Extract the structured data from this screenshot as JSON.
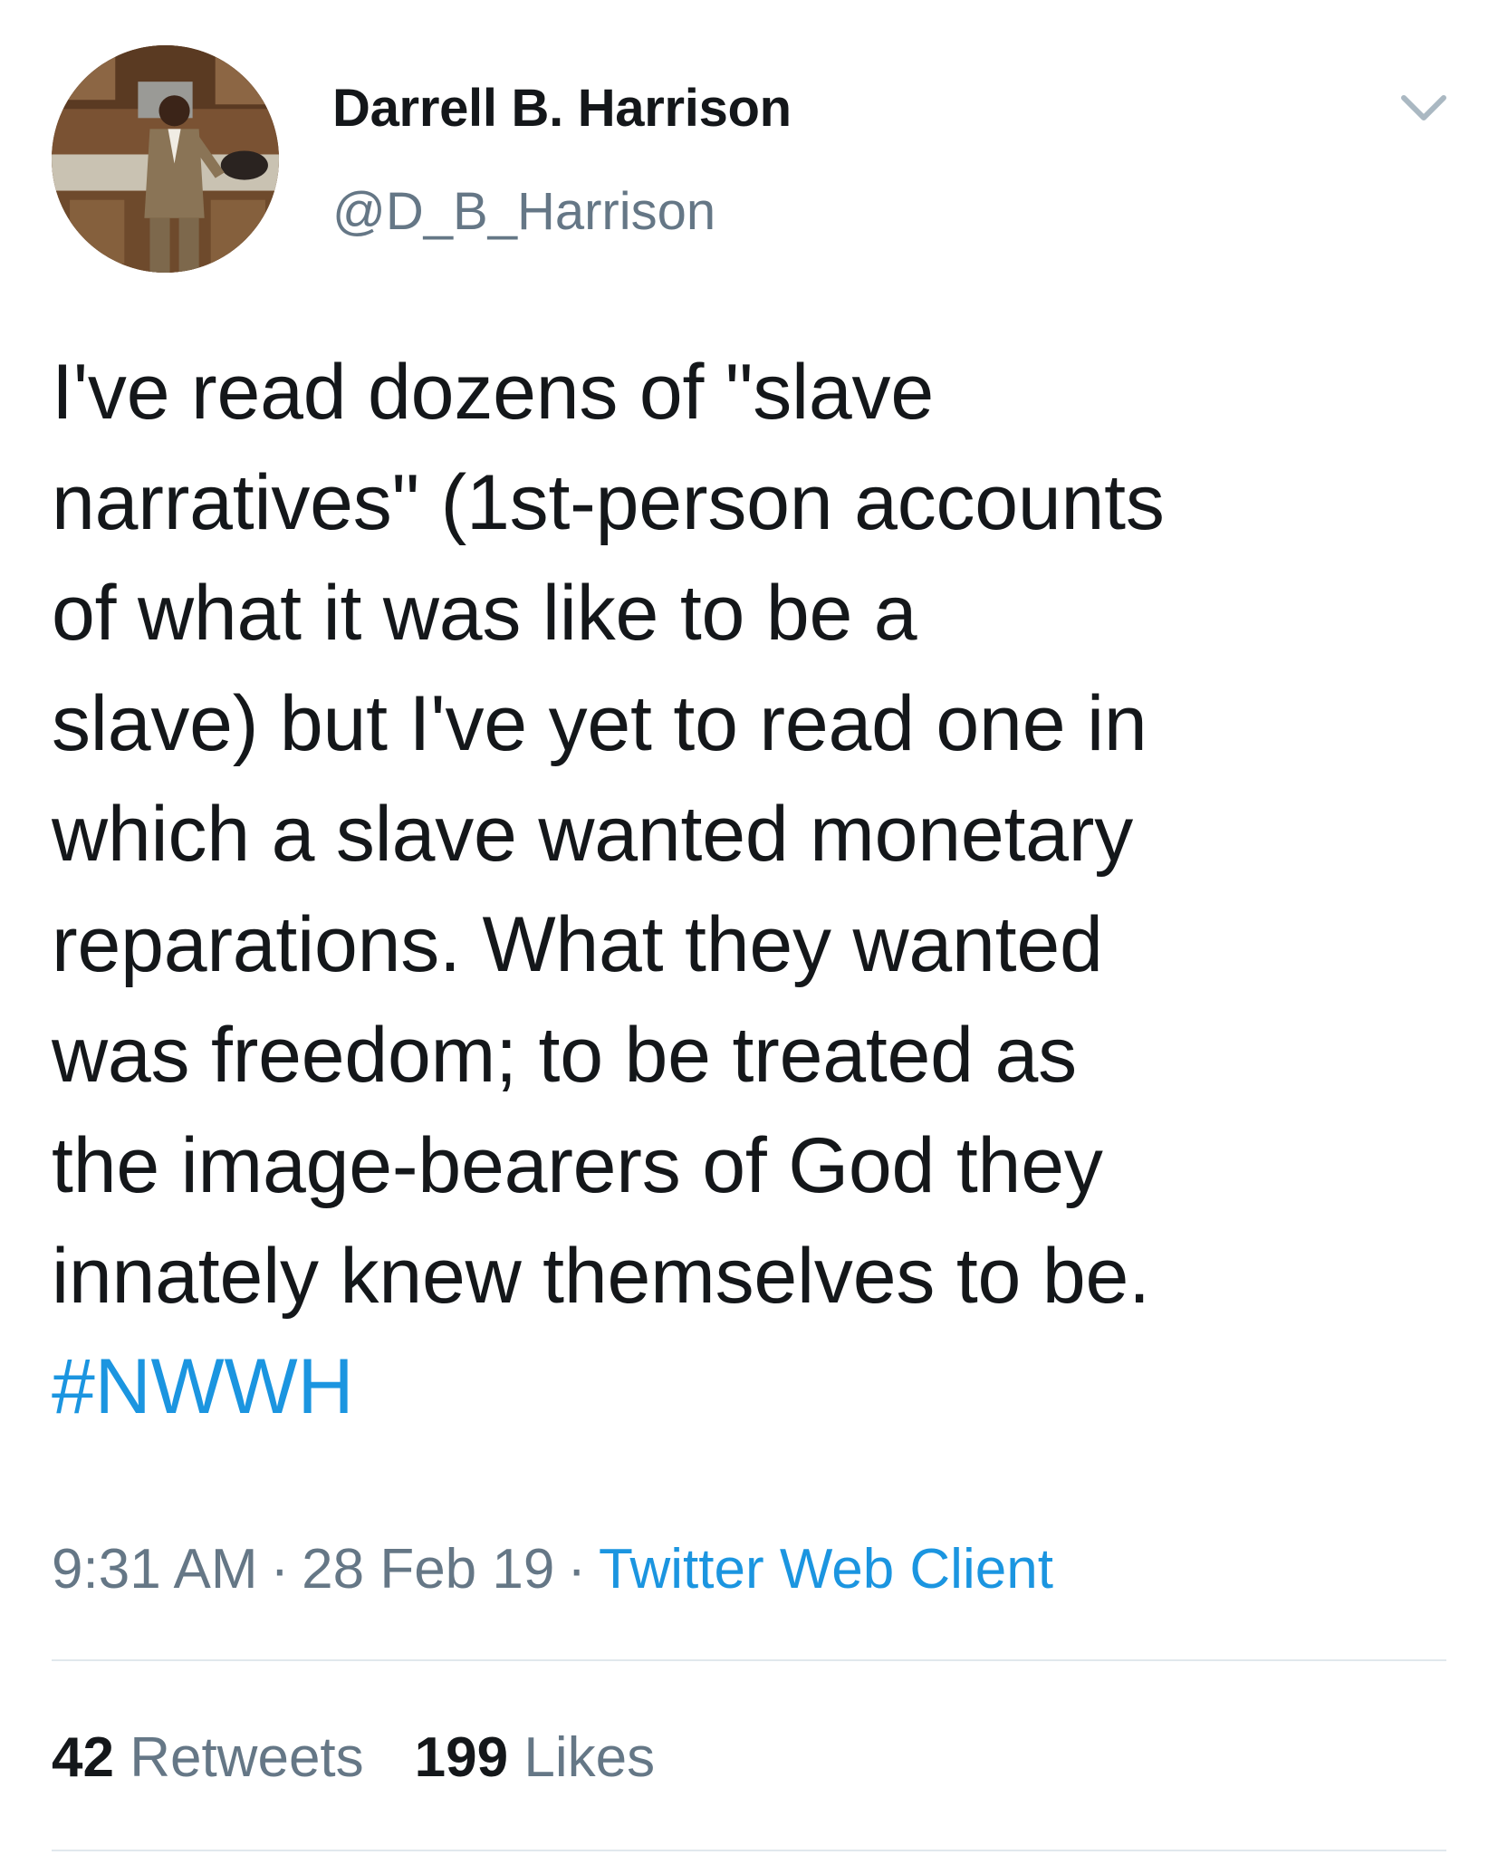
{
  "author": {
    "display_name": "Darrell B. Harrison",
    "handle": "@D_B_Harrison",
    "avatar_icon": "profile-photo-avatar"
  },
  "header": {
    "menu_icon": "chevron-down-icon"
  },
  "tweet": {
    "lines": [
      "I've read dozens of \"slave",
      "narratives\" (1st-person accounts",
      "of what it was like to be a",
      "slave) but I've yet to read one in",
      "which a slave wanted monetary",
      "reparations. What they wanted",
      "was freedom; to be treated as",
      "the image-bearers of God they",
      "innately knew themselves to be."
    ],
    "hashtag": "#NWWH"
  },
  "meta": {
    "time": "9:31 AM",
    "separator": "·",
    "date": "28 Feb 19",
    "source": "Twitter Web Client"
  },
  "stats": {
    "retweets_count": "42",
    "retweets_label": "Retweets",
    "likes_count": "199",
    "likes_label": "Likes"
  },
  "colors": {
    "text": "#14171a",
    "secondary": "#657786",
    "link": "#1b95e0",
    "divider": "#e1e8ed"
  }
}
